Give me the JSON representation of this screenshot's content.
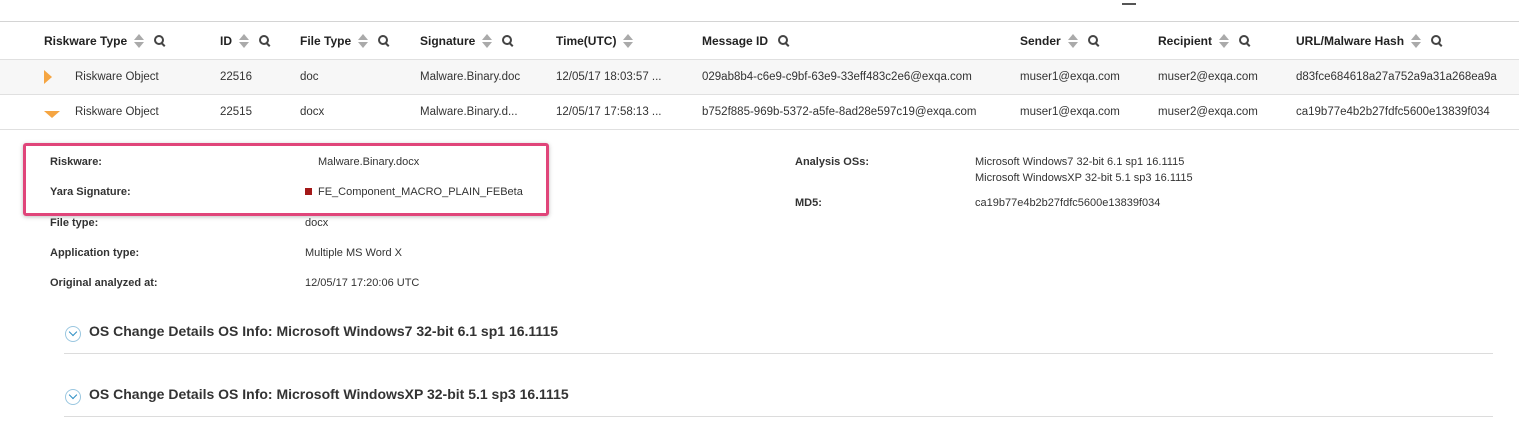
{
  "table": {
    "columns": [
      {
        "label": "Riskware Type",
        "sortable": true,
        "searchable": true
      },
      {
        "label": "ID",
        "sortable": true,
        "searchable": true
      },
      {
        "label": "File Type",
        "sortable": true,
        "searchable": true
      },
      {
        "label": "Signature",
        "sortable": true,
        "searchable": true
      },
      {
        "label": "Time(UTC)",
        "sortable": true,
        "searchable": false
      },
      {
        "label": "Message ID",
        "sortable": false,
        "searchable": true
      },
      {
        "label": "Sender",
        "sortable": true,
        "searchable": true
      },
      {
        "label": "Recipient",
        "sortable": true,
        "searchable": true
      },
      {
        "label": "URL/Malware Hash",
        "sortable": true,
        "searchable": true
      }
    ],
    "rows": [
      {
        "expanded": false,
        "type": "Riskware Object",
        "id": "22516",
        "file_type": "doc",
        "signature": "Malware.Binary.doc",
        "time": "12/05/17 18:03:57 ...",
        "message_id": "029ab8b4-c6e9-c9bf-63e9-33eff483c2e6@exqa.com",
        "sender": "muser1@exqa.com",
        "recipient": "muser2@exqa.com",
        "hash": "d83fce684618a27a752a9a31a268ea9a"
      },
      {
        "expanded": true,
        "type": "Riskware Object",
        "id": "22515",
        "file_type": "docx",
        "signature": "Malware.Binary.d...",
        "time": "12/05/17 17:58:13 ...",
        "message_id": "b752f885-969b-5372-a5fe-8ad28e597c19@exqa.com",
        "sender": "muser1@exqa.com",
        "recipient": "muser2@exqa.com",
        "hash": "ca19b77e4b2b27fdfc5600e13839f034"
      }
    ]
  },
  "details": {
    "riskware_label": "Riskware:",
    "riskware_value": "Malware.Binary.docx",
    "yara_label": "Yara Signature:",
    "yara_value": "FE_Component_MACRO_PLAIN_FEBeta",
    "yara_color": "#a31818",
    "file_type_label": "File type:",
    "file_type_value": "docx",
    "app_type_label": "Application type:",
    "app_type_value": "Multiple MS Word X",
    "analyzed_label": "Original analyzed at:",
    "analyzed_value": "12/05/17 17:20:06 UTC",
    "analysis_os_label": "Analysis OSs:",
    "analysis_os_values": [
      "Microsoft Windows7 32-bit 6.1 sp1 16.1115",
      "Microsoft WindowsXP 32-bit 5.1 sp3 16.1115"
    ],
    "md5_label": "MD5:",
    "md5_value": "ca19b77e4b2b27fdfc5600e13839f034"
  },
  "sections": [
    {
      "title": "OS Change Details OS Info: Microsoft Windows7 32-bit 6.1 sp1 16.1115"
    },
    {
      "title": "OS Change Details OS Info: Microsoft WindowsXP 32-bit 5.1 sp3 16.1115"
    }
  ],
  "colors": {
    "expand_arrow": "#f5a542",
    "highlight_border": "#e0457a",
    "chevron": "#2d8fc4"
  }
}
